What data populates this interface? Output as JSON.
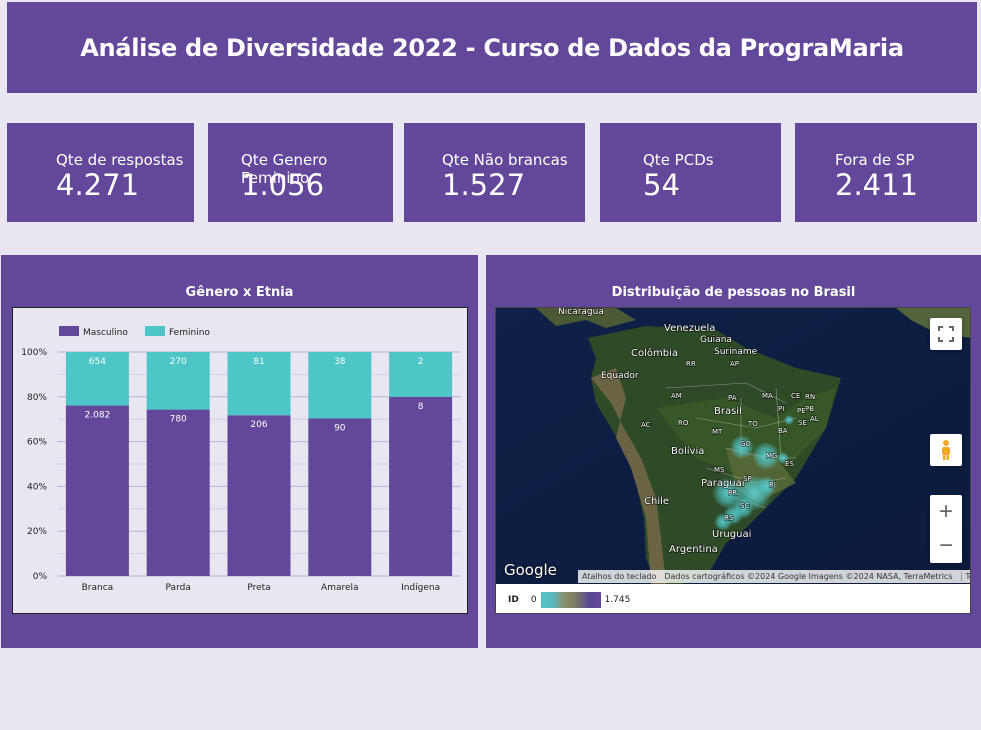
{
  "header": {
    "title": "Análise de Diversidade 2022 - Curso de Dados da PrograMaria"
  },
  "kpis": [
    {
      "label": "Qte de respostas",
      "value": "4.271"
    },
    {
      "label": "Qte Genero Feminino",
      "value": "1.056"
    },
    {
      "label": "Qte Não brancas",
      "value": "1.527"
    },
    {
      "label": "Qte PCDs",
      "value": "54"
    },
    {
      "label": "Fora de SP",
      "value": "2.411"
    }
  ],
  "chart_panel": {
    "title": "Gênero x Etnia"
  },
  "map_panel": {
    "title": "Distribuição de pessoas no Brasil",
    "google_logo": "Google",
    "attribution": {
      "shortcuts": "Atalhos do teclado",
      "data": "Dados cartográficos ©2024 Google Imagens ©2024 NASA, TerraMetrics",
      "terms": "Termos"
    },
    "legend": {
      "label": "ID",
      "min": "0",
      "max": "1.745"
    },
    "places": [
      "Nicaragua",
      "Venezuela",
      "Guiana",
      "Suriname",
      "Colômbia",
      "Equador",
      "Brasil",
      "Bolívia",
      "Paraguai",
      "Chile",
      "Argentina",
      "Uruguai",
      "AM",
      "PA",
      "MA",
      "CE",
      "RN",
      "PB",
      "PE",
      "AL",
      "SE",
      "RR",
      "AP",
      "PI",
      "TO",
      "RO",
      "MT",
      "BA",
      "GO",
      "MG",
      "ES",
      "MS",
      "SP",
      "RJ",
      "PR",
      "SC",
      "RS",
      "AC"
    ],
    "controls": {
      "fullscreen": "fullscreen-icon",
      "pegman": "pegman-icon",
      "zoom_in": "+",
      "zoom_out": "−"
    }
  },
  "chart_data": {
    "type": "bar",
    "stacked": true,
    "normalized": true,
    "categories": [
      "Branca",
      "Parda",
      "Preta",
      "Amarela",
      "Indígena"
    ],
    "series": [
      {
        "name": "Masculino",
        "values": [
          2082,
          780,
          206,
          90,
          8
        ],
        "labels": [
          "2.082",
          "780",
          "206",
          "90",
          "8"
        ],
        "color": "#63479a"
      },
      {
        "name": "Feminino",
        "values": [
          654,
          270,
          81,
          38,
          2
        ],
        "labels": [
          "654",
          "270",
          "81",
          "38",
          "2"
        ],
        "color": "#4ec5c7"
      }
    ],
    "yticks": [
      "0%",
      "20%",
      "40%",
      "60%",
      "80%",
      "100%"
    ],
    "ylim": [
      0,
      100
    ],
    "legend_position": "top-left",
    "grid": true
  },
  "colors": {
    "background": "#e8e6f1",
    "panel": "#63479a",
    "masculino": "#63479a",
    "feminino": "#4ec5c7"
  }
}
